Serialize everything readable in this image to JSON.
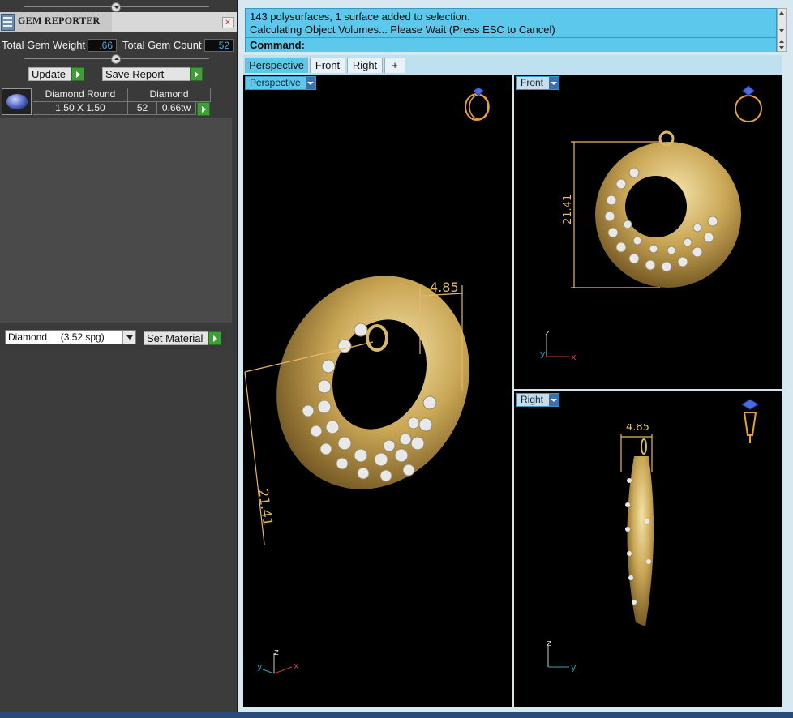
{
  "panel": {
    "title": "GEM REPORTER",
    "close_symbol": "×",
    "total_weight_label": "Total Gem Weight",
    "total_weight_value": ".66",
    "total_count_label": "Total Gem Count",
    "total_count_value": "52",
    "update_label": "Update",
    "save_report_label": "Save Report",
    "table": {
      "headers": [
        "Diamond Round",
        "Diamond"
      ],
      "row": {
        "size": "1.50 X 1.50",
        "count": "52",
        "weight": "0.66tw"
      }
    },
    "material_select": "Diamond     (3.52 spg)",
    "set_material_label": "Set Material"
  },
  "command": {
    "line1": "143 polysurfaces, 1 surface added to selection.",
    "line2": "Calculating Object Volumes... Please Wait (Press ESC to Cancel)",
    "prompt": "Command:"
  },
  "tabs": [
    "Perspective",
    "Front",
    "Right"
  ],
  "add_tab_symbol": "+",
  "viewports": {
    "perspective": {
      "label": "Perspective",
      "dim_height": "21.41",
      "dim_depth": "4.85"
    },
    "front": {
      "label": "Front",
      "dim_height": "21.41"
    },
    "right": {
      "label": "Right",
      "dim_depth": "4.85"
    }
  },
  "axes": {
    "x": "x",
    "y": "y",
    "z": "z"
  },
  "colors": {
    "accent": "#5bc8ec",
    "panel_bg": "#3a3a3a",
    "gold": "#c9a655",
    "dimension": "#e8b86a",
    "axis_x": "#d03a3a",
    "axis_y": "#3aa0c0",
    "gem_blue": "#4a6ce0"
  },
  "icons": [
    "app-icon",
    "close-icon",
    "gem-thumbnail-icon",
    "arrow-right-icon",
    "dropdown-icon",
    "ring-icon",
    "earring-icon",
    "add-tab-icon"
  ]
}
